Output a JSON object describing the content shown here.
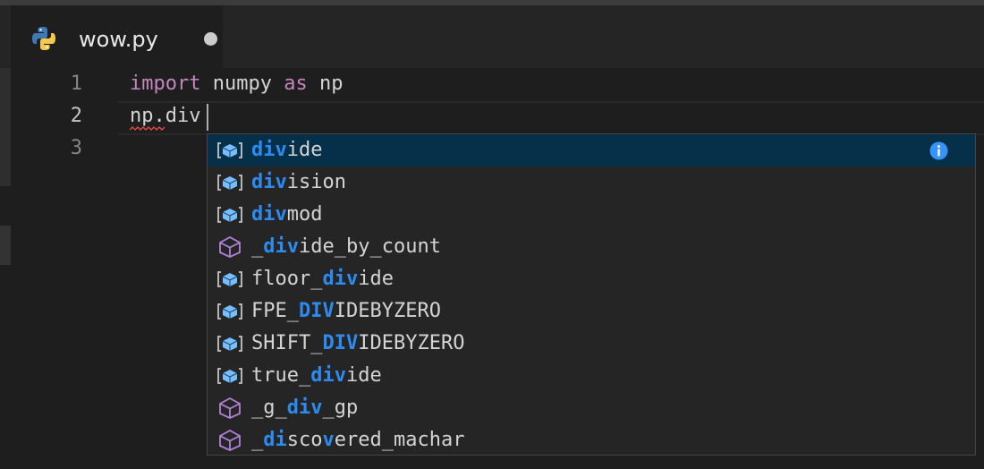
{
  "tab": {
    "file_name": "wow.py",
    "language_icon": "python-icon",
    "dirty": true
  },
  "editor": {
    "lines": [
      {
        "number": "1",
        "tokens": [
          {
            "text": "import",
            "kind": "keyword"
          },
          {
            "text": " numpy ",
            "kind": "plain"
          },
          {
            "text": "as",
            "kind": "keyword"
          },
          {
            "text": " np",
            "kind": "plain"
          }
        ]
      },
      {
        "number": "2",
        "tokens": [
          {
            "text": "np.div",
            "kind": "plain"
          }
        ]
      },
      {
        "number": "3",
        "tokens": []
      }
    ],
    "active_line": 2
  },
  "suggest": {
    "items": [
      {
        "icon": "field-icon",
        "parts": [
          {
            "text": "div",
            "hl": true
          },
          {
            "text": "ide",
            "hl": false
          }
        ]
      },
      {
        "icon": "field-icon",
        "parts": [
          {
            "text": "div",
            "hl": true
          },
          {
            "text": "ision",
            "hl": false
          }
        ]
      },
      {
        "icon": "field-icon",
        "parts": [
          {
            "text": "div",
            "hl": true
          },
          {
            "text": "mod",
            "hl": false
          }
        ]
      },
      {
        "icon": "module-icon",
        "parts": [
          {
            "text": "_",
            "hl": false
          },
          {
            "text": "div",
            "hl": true
          },
          {
            "text": "ide_by_count",
            "hl": false
          }
        ]
      },
      {
        "icon": "field-icon",
        "parts": [
          {
            "text": "floor_",
            "hl": false
          },
          {
            "text": "div",
            "hl": true
          },
          {
            "text": "ide",
            "hl": false
          }
        ]
      },
      {
        "icon": "field-icon",
        "parts": [
          {
            "text": "FPE_",
            "hl": false
          },
          {
            "text": "DIV",
            "hl": true
          },
          {
            "text": "IDEBYZERO",
            "hl": false
          }
        ]
      },
      {
        "icon": "field-icon",
        "parts": [
          {
            "text": "SHIFT_",
            "hl": false
          },
          {
            "text": "DIV",
            "hl": true
          },
          {
            "text": "IDEBYZERO",
            "hl": false
          }
        ]
      },
      {
        "icon": "field-icon",
        "parts": [
          {
            "text": "true_",
            "hl": false
          },
          {
            "text": "div",
            "hl": true
          },
          {
            "text": "ide",
            "hl": false
          }
        ]
      },
      {
        "icon": "module-icon",
        "parts": [
          {
            "text": "_g_",
            "hl": false
          },
          {
            "text": "div",
            "hl": true
          },
          {
            "text": "_gp",
            "hl": false
          }
        ]
      },
      {
        "icon": "module-icon",
        "parts": [
          {
            "text": "_",
            "hl": false
          },
          {
            "text": "di",
            "hl": true
          },
          {
            "text": "sco",
            "hl": false
          },
          {
            "text": "v",
            "hl": true
          },
          {
            "text": "ered_machar",
            "hl": false
          }
        ]
      }
    ],
    "selected_index": 0,
    "details_icon": "info-icon"
  },
  "colors": {
    "keyword": "#c586c0",
    "match_highlight": "#2d8bf0",
    "selected_row": "#062f4a",
    "field_icon": "#75beff",
    "module_icon": "#b180d7"
  }
}
